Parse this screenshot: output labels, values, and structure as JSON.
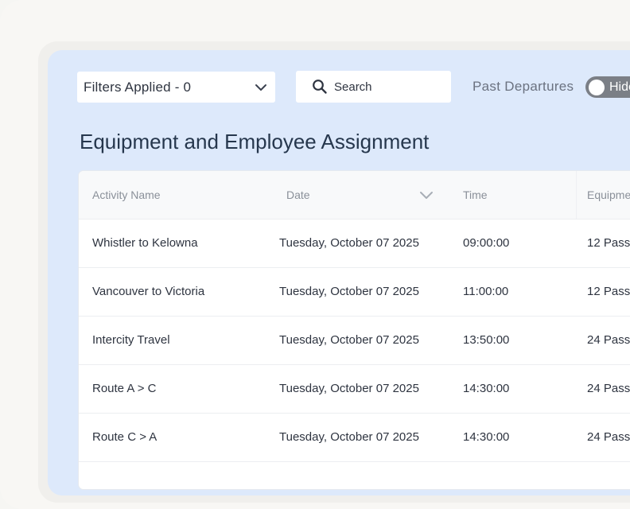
{
  "toolbar": {
    "filter_label": "Filters Applied - 0",
    "search_placeholder": "Search",
    "past_departures_label": "Past Departures",
    "toggle_label": "Hide"
  },
  "page": {
    "title": "Equipment and Employee Assignment"
  },
  "table": {
    "columns": [
      "Activity Name",
      "Date",
      "Time",
      "Equipme"
    ],
    "rows": [
      {
        "activity": "Whistler to Kelowna",
        "date": "Tuesday, October 07 2025",
        "time": "09:00:00",
        "equipment": "12 Pass"
      },
      {
        "activity": "Vancouver to Victoria",
        "date": "Tuesday, October 07 2025",
        "time": "11:00:00",
        "equipment": "12 Pass"
      },
      {
        "activity": "Intercity Travel",
        "date": "Tuesday, October 07 2025",
        "time": "13:50:00",
        "equipment": "24 Pass"
      },
      {
        "activity": "Route A > C",
        "date": "Tuesday, October 07 2025",
        "time": "14:30:00",
        "equipment": "24 Pass"
      },
      {
        "activity": "Route C > A",
        "date": "Tuesday, October 07 2025",
        "time": "14:30:00",
        "equipment": "24 Pass"
      }
    ]
  },
  "colors": {
    "panel_bg": "#dde9fb",
    "title_text": "#26374d",
    "toggle_bg": "#7b7f86"
  },
  "icons": {
    "filter_dropdown": "chevron-down-icon",
    "search": "search-icon",
    "date_sort": "chevron-down-icon"
  }
}
